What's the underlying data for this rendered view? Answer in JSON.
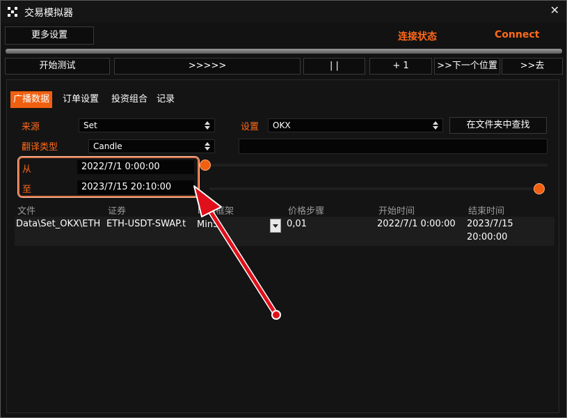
{
  "window": {
    "title": "交易模拟器",
    "close_glyph": "✕"
  },
  "toolbar": {
    "more_settings": "更多设置",
    "connection_status": "连接状态",
    "connect": "Connect"
  },
  "controls": {
    "start_test": "开始测试",
    "fast_forward": ">>>>>",
    "pause": "| |",
    "plus_one": "+ 1",
    "next_position": ">>下一个位置",
    "goto": ">>去"
  },
  "tabs": [
    "广播数据",
    "订单设置",
    "投资组合",
    "记录"
  ],
  "form": {
    "source_label": "来源",
    "source_value": "Set",
    "settings_label": "设置",
    "settings_value": "OKX",
    "find_in_folder": "在文件夹中查找",
    "translate_type_label": "翻译类型",
    "translate_type_value": "Candle",
    "from_label": "从",
    "from_value": "2022/7/1 0:00:00",
    "to_label": "至",
    "to_value": "2023/7/15 20:10:00"
  },
  "table": {
    "headers": [
      "文件",
      "证券",
      "时间框架",
      "价格步骤",
      "开始时间",
      "结束时间"
    ],
    "rows": [
      {
        "file": "Data\\Set_OKX\\ETH",
        "security": "ETH-USDT-SWAP.t",
        "timeframe": "Min5",
        "price_step": "0,01",
        "start_time": "2022/7/1 0:00:00",
        "end_time_date": "2023/7/15",
        "end_time_clock": "20:00:00"
      }
    ]
  },
  "colors": {
    "accent": "#f06010",
    "accent_text": "#ff6a1a",
    "annotation": "#e0101a"
  }
}
